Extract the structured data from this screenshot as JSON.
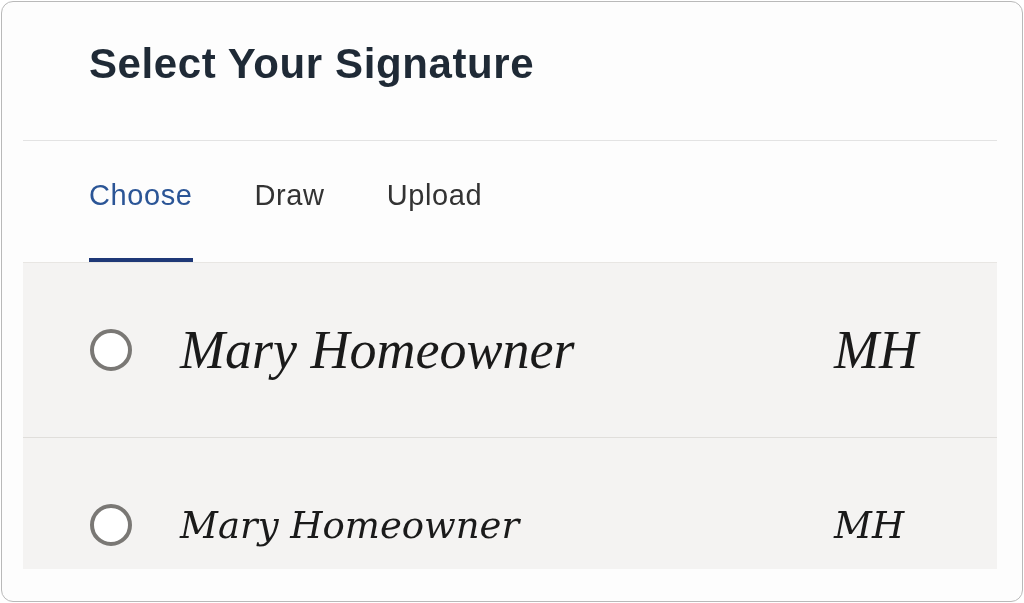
{
  "title": "Select Your Signature",
  "tabs": [
    {
      "label": "Choose",
      "selected": true
    },
    {
      "label": "Draw",
      "selected": false
    },
    {
      "label": "Upload",
      "selected": false
    }
  ],
  "signatures": [
    {
      "name": "Mary Homeowner",
      "initials": "MH",
      "selected": false
    },
    {
      "name": "Mary Homeowner",
      "initials": "MH",
      "selected": false
    }
  ]
}
